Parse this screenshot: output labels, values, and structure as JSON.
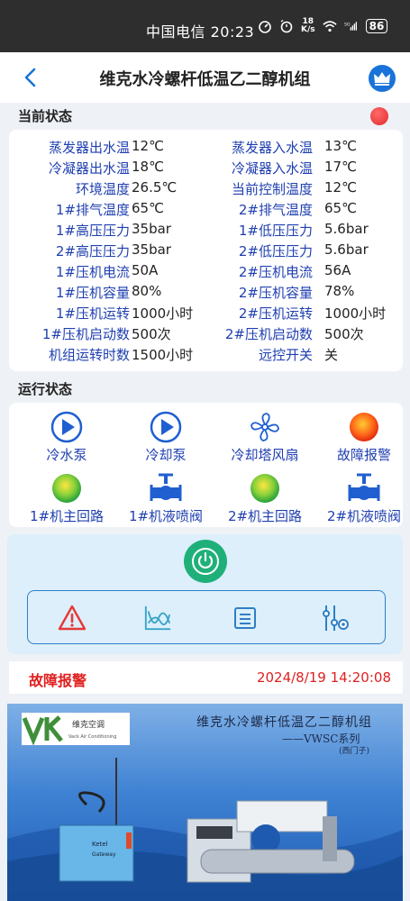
{
  "statusbar": {
    "carrier": "中国电信",
    "time": "20:23",
    "net_speed_top": "18",
    "net_speed_bottom": "K/s",
    "battery": "86"
  },
  "appbar": {
    "title": "维克水冷螺杆低温乙二醇机组"
  },
  "current_status": {
    "heading": "当前状态",
    "rows": [
      {
        "l1": "蒸发器出水温",
        "v1": "12℃",
        "l2": "蒸发器入水温",
        "v2": "13℃"
      },
      {
        "l1": "冷凝器出水温",
        "v1": "18℃",
        "l2": "冷凝器入水温",
        "v2": "17℃"
      },
      {
        "l1": "环境温度",
        "v1": "26.5℃",
        "l2": "当前控制温度",
        "v2": "12℃"
      },
      {
        "l1": "1#排气温度",
        "v1": "65℃",
        "l2": "2#排气温度",
        "v2": "65℃"
      },
      {
        "l1": "1#高压压力",
        "v1": "35bar",
        "l2": "1#低压压力",
        "v2": "5.6bar"
      },
      {
        "l1": "2#高压压力",
        "v1": "35bar",
        "l2": "2#低压压力",
        "v2": "5.6bar"
      },
      {
        "l1": "1#压机电流",
        "v1": "50A",
        "l2": "2#压机电流",
        "v2": "56A"
      },
      {
        "l1": "1#压机容量",
        "v1": "80%",
        "l2": "2#压机容量",
        "v2": "78%"
      },
      {
        "l1": "1#压机运转",
        "v1": "1000小时",
        "l2": "2#压机运转",
        "v2": "1000小时"
      },
      {
        "l1": "1#压机启动数",
        "v1": "500次",
        "l2": "2#压机启动数",
        "v2": "500次"
      },
      {
        "l1": "机组运转时数",
        "v1": "1500小时",
        "l2": "远控开关",
        "v2": "关"
      }
    ]
  },
  "run_status": {
    "heading": "运行状态",
    "items": [
      {
        "label": "冷水泵",
        "icon": "play-icon"
      },
      {
        "label": "冷却泵",
        "icon": "play-icon"
      },
      {
        "label": "冷却塔风扇",
        "icon": "fan-icon"
      },
      {
        "label": "故障报警",
        "icon": "alarm-lamp-icon"
      },
      {
        "label": "1#机主回路",
        "icon": "green-lamp-icon"
      },
      {
        "label": "1#机液喷阀",
        "icon": "valve-icon"
      },
      {
        "label": "2#机主回路",
        "icon": "green-lamp-icon"
      },
      {
        "label": "2#机液喷阀",
        "icon": "valve-icon"
      }
    ]
  },
  "alarm": {
    "label": "故障报警",
    "time": "2024/8/19 14:20:08"
  },
  "banner": {
    "logo_name": "维克空调",
    "logo_sub": "Vack Air Conditioning",
    "title": "维克水冷螺杆低温乙二醇机组",
    "subtitle": "——VWSC系列",
    "subtitle2": "(西门子)",
    "gateway_brand": "Ketel",
    "gateway_label": "Gateway"
  },
  "colors": {
    "accent": "#1f3fb0",
    "alarm": "#e02020",
    "power": "#1fb07a",
    "panel": "#dceffb"
  }
}
